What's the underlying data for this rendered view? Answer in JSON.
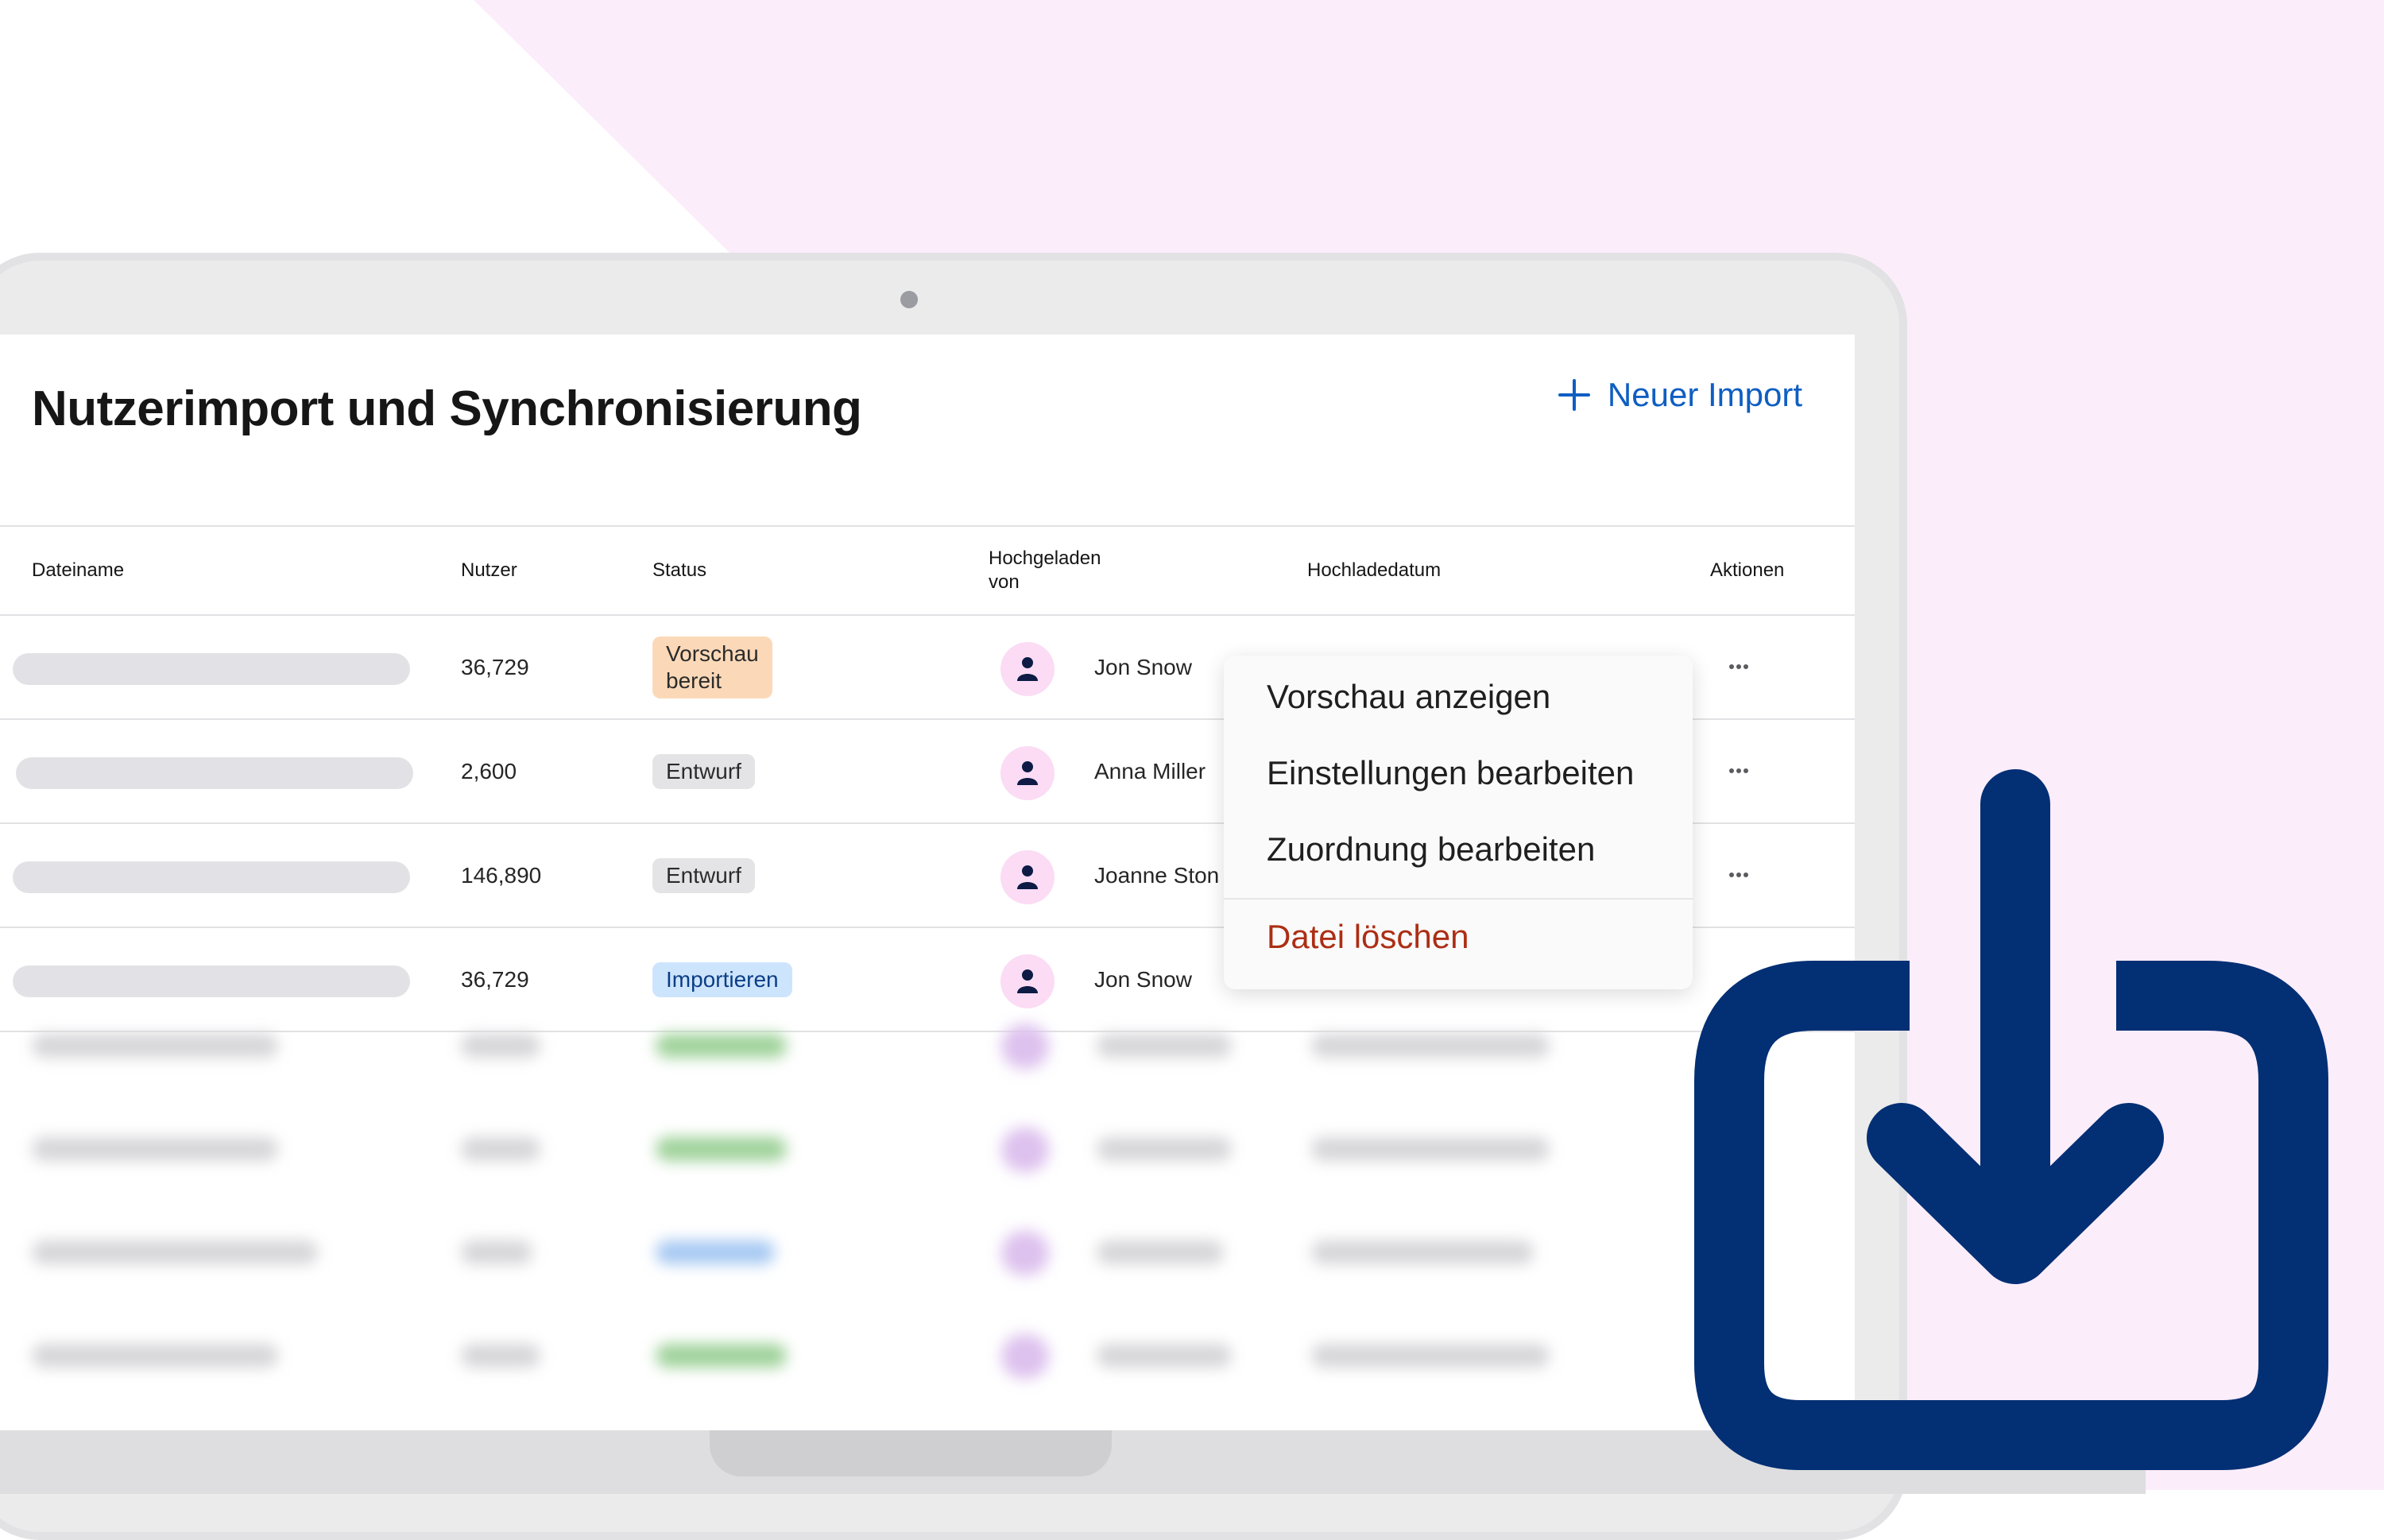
{
  "page": {
    "title": "Nutzerimport und Synchronisierung",
    "new_import_label": "Neuer Import"
  },
  "table": {
    "columns": {
      "file": "Dateiname",
      "users": "Nutzer",
      "status": "Status",
      "uploaded_by_line1": "Hochgeladen",
      "uploaded_by_line2": "von",
      "date": "Hochladedatum",
      "actions": "Aktionen"
    },
    "rows": [
      {
        "users": "36,729",
        "status_line1": "Vorschau",
        "status_line2": "bereit",
        "uploader": "Jon Snow"
      },
      {
        "users": "2,600",
        "status": "Entwurf",
        "uploader": "Anna Miller"
      },
      {
        "users": "146,890",
        "status": "Entwurf",
        "uploader": "Joanne Ston"
      },
      {
        "users": "36,729",
        "status": "Importieren",
        "uploader": "Jon Snow"
      }
    ]
  },
  "dropdown": {
    "items": [
      "Vorschau anzeigen",
      "Einstellungen bearbeiten",
      "Zuordnung bearbeiten"
    ],
    "delete_label": "Datei löschen"
  },
  "icons": {
    "new_import": "plus-icon",
    "row_actions": "more-horizontal-icon",
    "avatar": "user-icon",
    "overlay": "download-icon"
  },
  "colors": {
    "accent_blue": "#0f5ec2",
    "download_icon_navy": "#032f74",
    "background_pink": "#fcedfb",
    "danger": "#ac2e14",
    "badge_preview": "#fbd9b8",
    "badge_draft": "#e4e4e6",
    "badge_import": "#cde4fd",
    "avatar_bg": "#fbdcf4"
  }
}
